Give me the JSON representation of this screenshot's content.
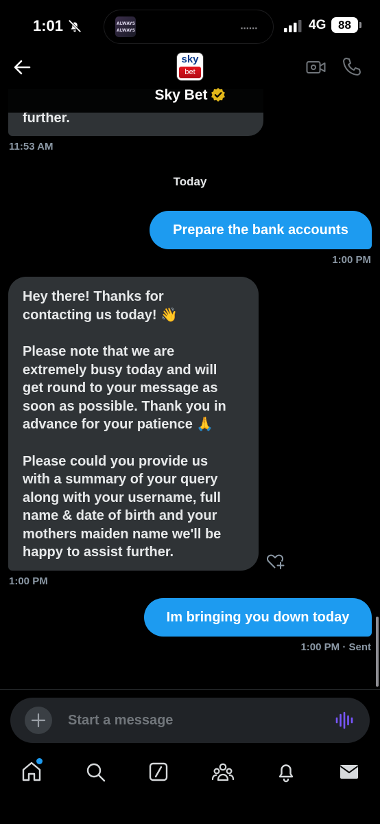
{
  "status_bar": {
    "time": "1:01",
    "network": "4G",
    "battery": "88",
    "island_thumb_text": "ALWAYS"
  },
  "header": {
    "contact_name": "Sky Bet",
    "logo_top": "sky",
    "logo_bottom": "bet"
  },
  "messages": [
    {
      "direction": "incoming",
      "text": "further.",
      "time": "11:53 AM"
    },
    {
      "type": "divider",
      "text": "Today"
    },
    {
      "direction": "outgoing",
      "text": "Prepare the bank accounts",
      "time": "1:00 PM"
    },
    {
      "direction": "incoming",
      "paragraphs": [
        [
          "Hey there! Thanks for",
          "contacting us today! 👋"
        ],
        [
          "Please note that we are",
          "extremely busy today and will",
          "get round to your message as",
          "soon as possible. Thank you in",
          "advance for your patience 🙏"
        ],
        [
          "Please could you provide us",
          "with a summary of your query",
          "along with your username, full",
          "name & date of birth and your",
          "mothers maiden name we'll be",
          "happy to assist further."
        ]
      ],
      "time": "1:00 PM"
    },
    {
      "direction": "outgoing",
      "text": "Im bringing you down today",
      "time": "1:00 PM · Sent"
    }
  ],
  "composer": {
    "placeholder": "Start a message"
  },
  "tabs": [
    "home-icon",
    "search-icon",
    "grok-icon",
    "communities-icon",
    "notifications-icon",
    "messages-icon"
  ],
  "colors": {
    "accent": "#1d9bf0",
    "bubble_in": "#2f3336",
    "voice": "#7856ff"
  }
}
